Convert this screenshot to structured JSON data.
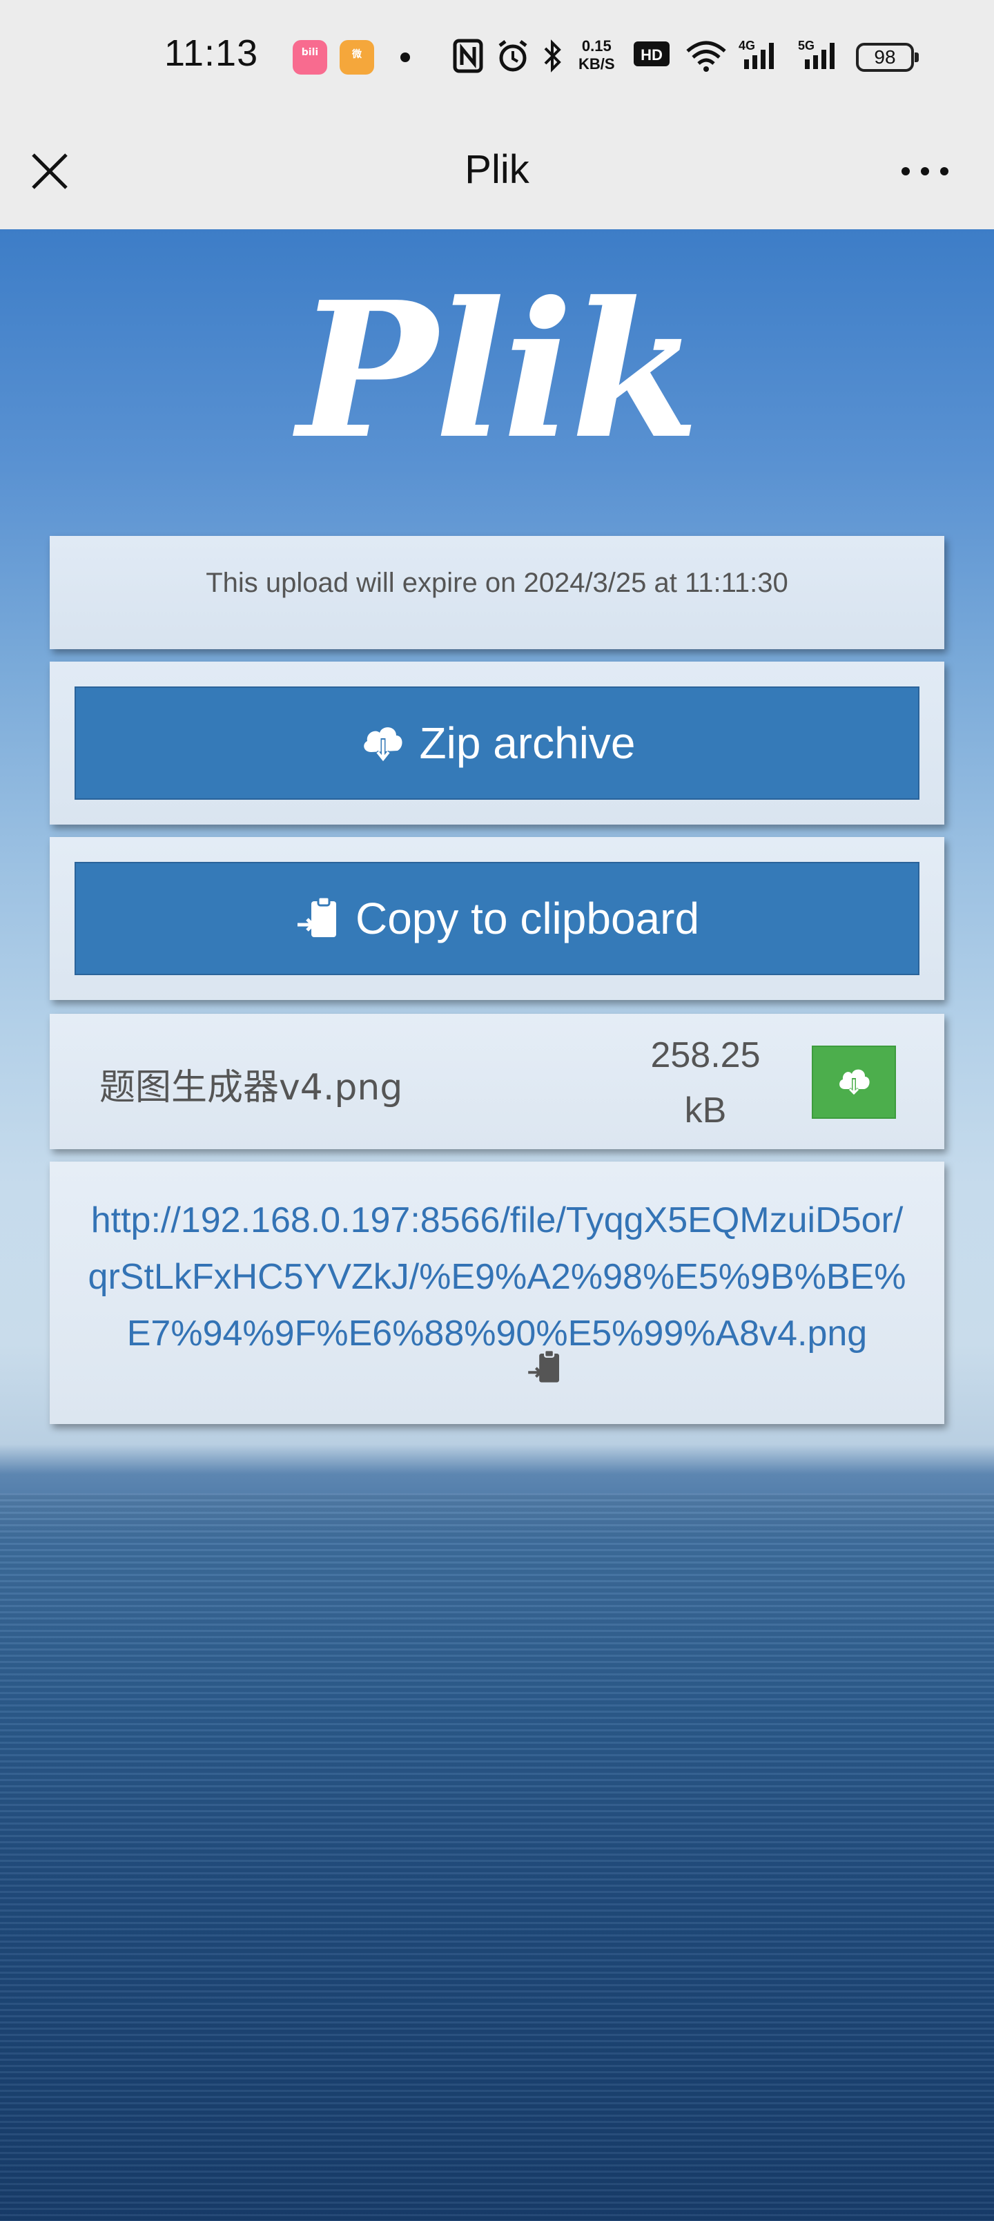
{
  "status_bar": {
    "time": "11:13",
    "app_icons": [
      "bilibili-icon",
      "weibo-icon"
    ],
    "net_speed_value": "0.15",
    "net_speed_unit": "KB/S",
    "hd_label": "HD",
    "net_4g": "4G",
    "net_5g": "5G",
    "battery": "98"
  },
  "nav": {
    "title": "Plik",
    "close_icon": "close-icon",
    "more_icon": "more-icon"
  },
  "main": {
    "logo_text": "Plik",
    "expire_text": "This upload will expire on 2024/3/25 at 11:11:30",
    "zip_button": "Zip archive",
    "copy_button": "Copy to clipboard",
    "file": {
      "name": "题图生成器v4.png",
      "size_value": "258.25",
      "size_unit": "kB"
    },
    "file_url": "http://192.168.0.197:8566/file/TyqgX5EQMzuiD5or/qrStLkFxHC5YVZkJ/%E9%A2%98%E5%9B%BE%E7%94%9F%E6%88%90%E5%99%A8v4.png"
  },
  "colors": {
    "primary_button": "#357ab8",
    "download_button": "#4cae4c",
    "link": "#3373b5"
  }
}
